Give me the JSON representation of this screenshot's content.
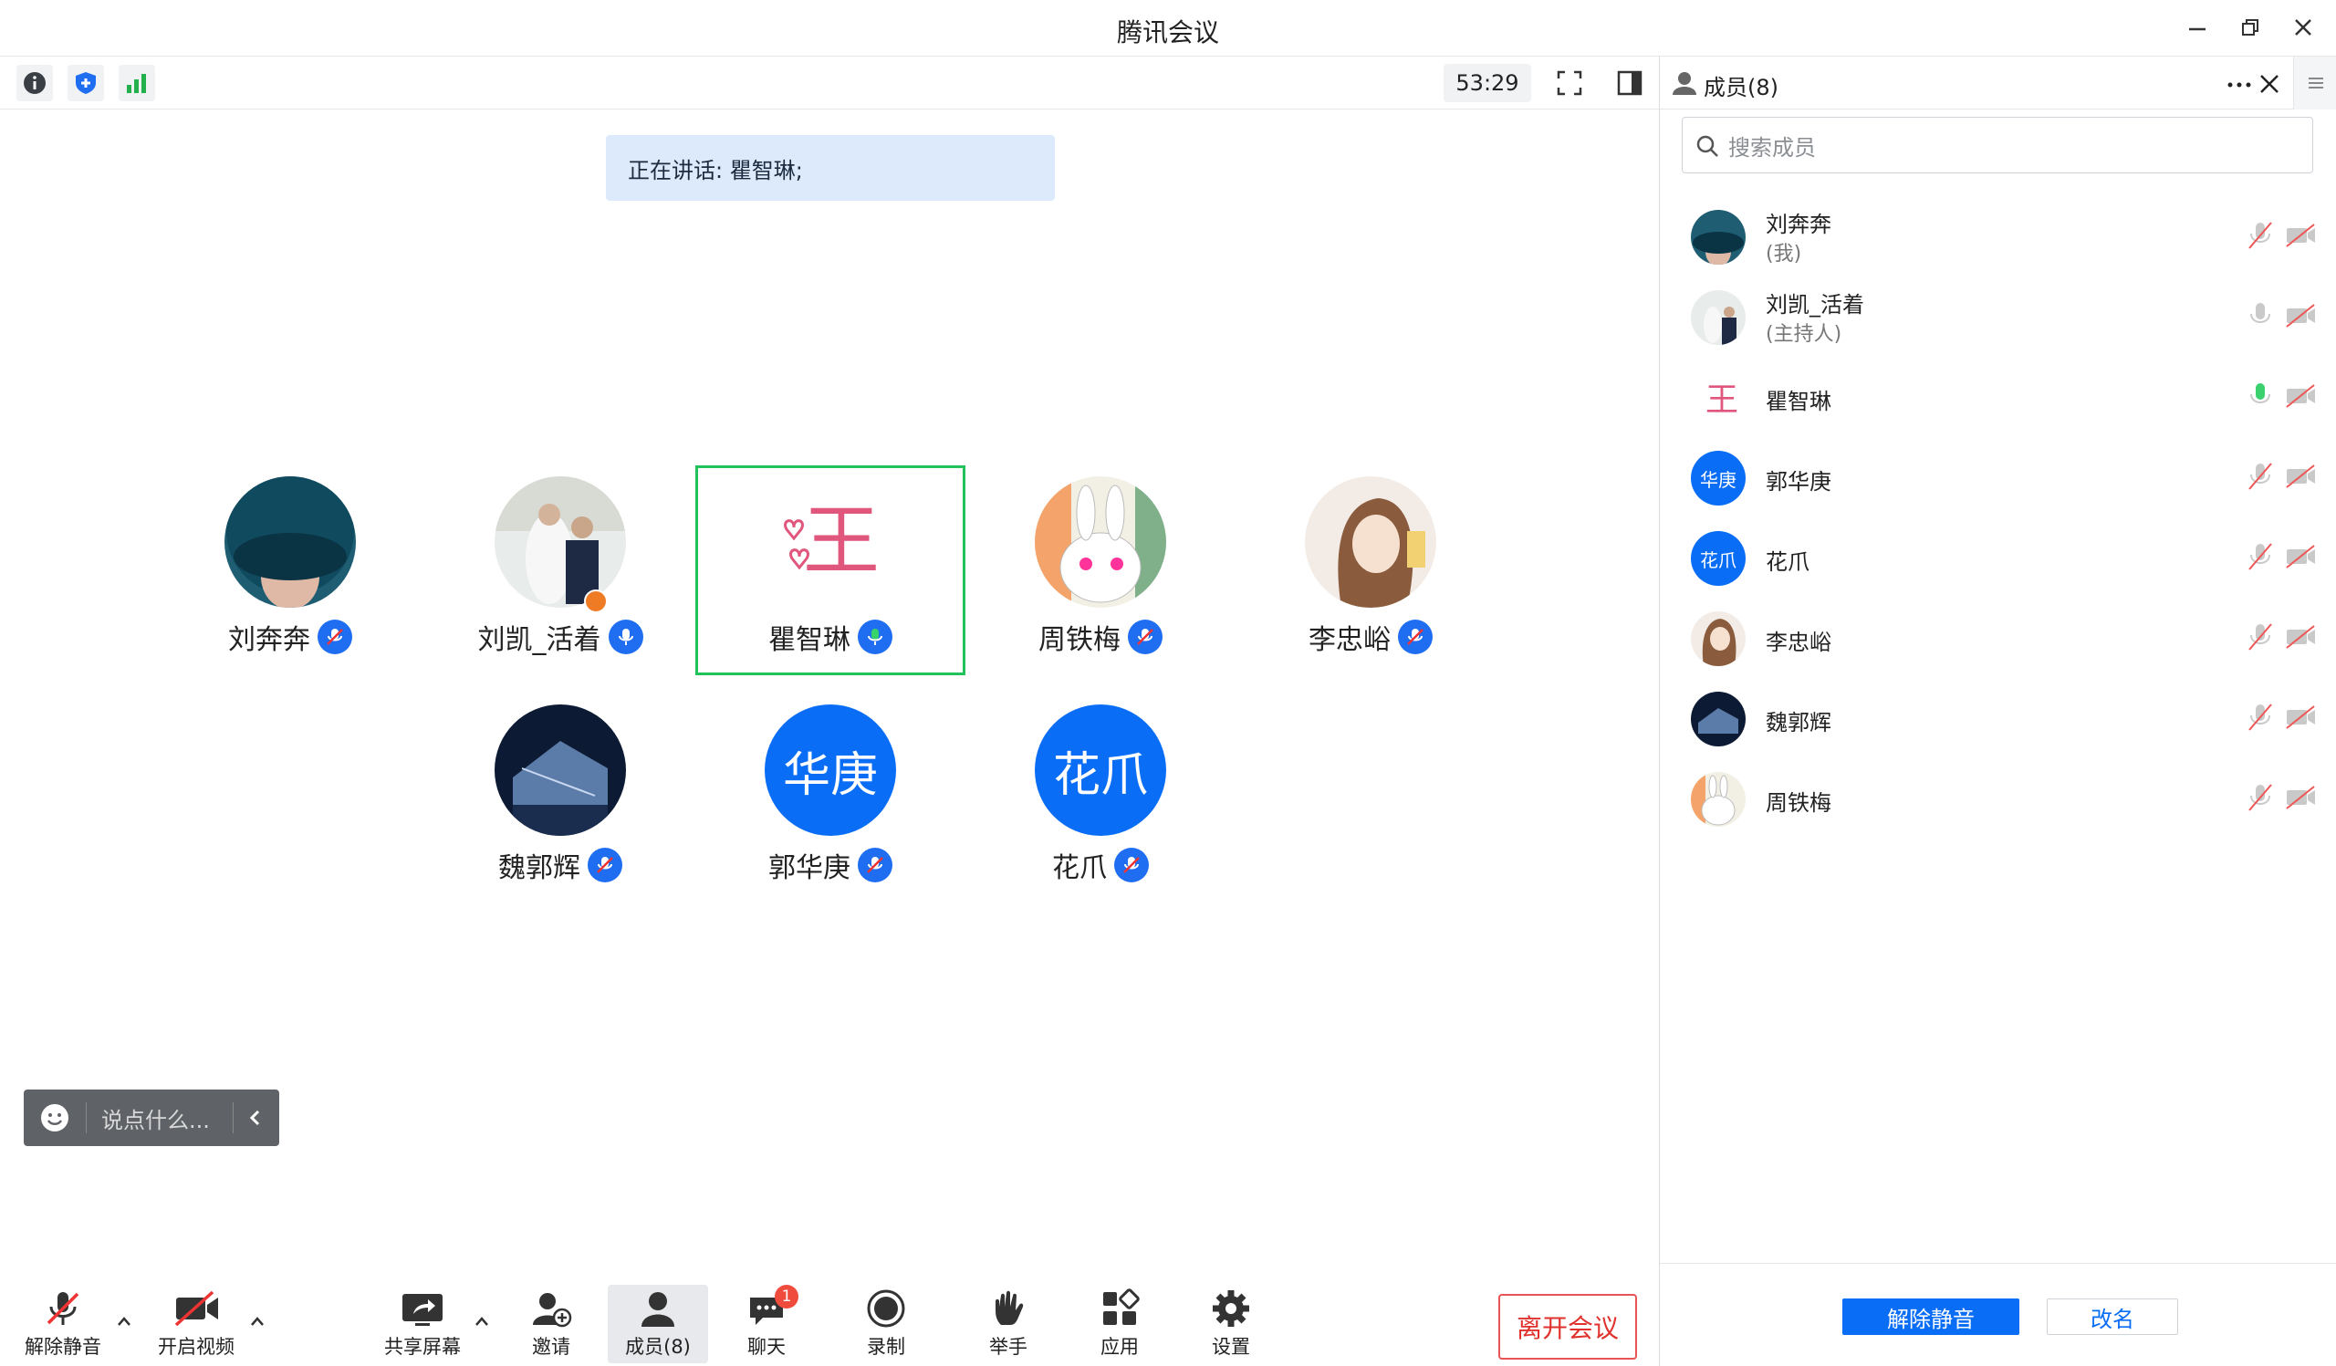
{
  "window": {
    "title": "腾讯会议"
  },
  "topbar": {
    "timer": "53:29"
  },
  "speaking": {
    "label": "正在讲话: 瞿智琳;"
  },
  "participants": [
    {
      "name": "刘奔奔"
    },
    {
      "name": "刘凯_活着"
    },
    {
      "name": "瞿智琳"
    },
    {
      "name": "周铁梅"
    },
    {
      "name": "李忠峪"
    },
    {
      "name": "魏郭辉"
    },
    {
      "name": "郭华庚",
      "initials": "华庚"
    },
    {
      "name": "花爪",
      "initials": "花爪"
    }
  ],
  "chat": {
    "placeholder": "说点什么..."
  },
  "toolbar": {
    "unmute": "解除静音",
    "video": "开启视频",
    "share": "共享屏幕",
    "invite": "邀请",
    "members": "成员(8)",
    "chat": "聊天",
    "chat_badge": "1",
    "record": "录制",
    "raise": "举手",
    "apps": "应用",
    "settings": "设置",
    "leave": "离开会议"
  },
  "panel": {
    "title": "成员(8)",
    "search_placeholder": "搜索成员",
    "members": [
      {
        "name": "刘奔奔",
        "sub": "(我)"
      },
      {
        "name": "刘凯_活着",
        "sub": "(主持人)"
      },
      {
        "name": "瞿智琳"
      },
      {
        "name": "郭华庚",
        "initials": "华庚"
      },
      {
        "name": "花爪",
        "initials": "花爪"
      },
      {
        "name": "李忠峪"
      },
      {
        "name": "魏郭辉"
      },
      {
        "name": "周铁梅"
      }
    ],
    "unmute_all": "解除静音",
    "rename": "改名"
  },
  "colors": {
    "accent": "#0a6df5",
    "speaking_bg": "#ddeafc",
    "active_border": "#21c15b",
    "leave": "#e0312c"
  }
}
